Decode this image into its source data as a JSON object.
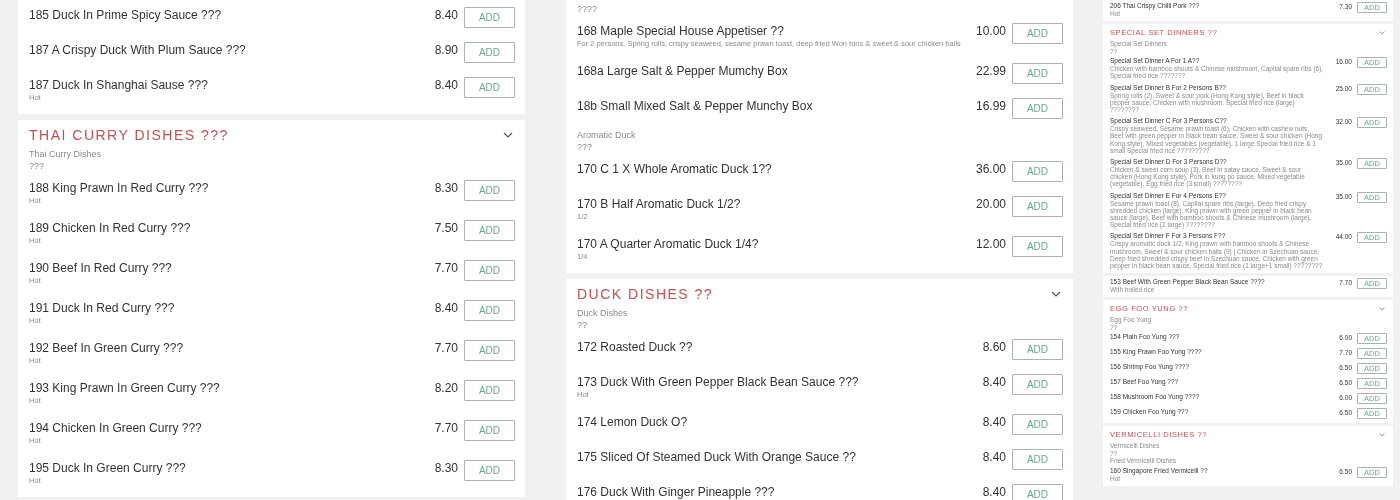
{
  "columns": [
    {
      "kind": "full",
      "cards": [
        {
          "rows": [
            {
              "kind": "item",
              "name": "185 Duck In Prime Spicy Sauce ???",
              "price": "8.40",
              "button": "ADD"
            },
            {
              "kind": "item",
              "name": "187 A Crispy Duck With Plum Sauce ???",
              "price": "8.90",
              "button": "ADD"
            },
            {
              "kind": "item",
              "name": "187 Duck In Shanghai Sause ???",
              "detail": "Hot",
              "price": "8.40",
              "button": "ADD"
            }
          ]
        },
        {
          "heading": "THAI CURRY DISHES ???",
          "rows": [
            {
              "kind": "subheading",
              "lines": [
                "Thai Curry Dishes",
                "???"
              ]
            },
            {
              "kind": "item",
              "name": "188 King Prawn In Red Curry ???",
              "detail": "Hot",
              "price": "8.30",
              "button": "ADD"
            },
            {
              "kind": "item",
              "name": "189 Chicken In Red Curry ???",
              "detail": "Hot",
              "price": "7.50",
              "button": "ADD"
            },
            {
              "kind": "item",
              "name": "190 Beef In Red Curry ???",
              "detail": "Hot",
              "price": "7.70",
              "button": "ADD"
            },
            {
              "kind": "item",
              "name": "191 Duck In Red Curry ???",
              "detail": "Hot",
              "price": "8.40",
              "button": "ADD"
            },
            {
              "kind": "item",
              "name": "192 Beef In Green Curry ???",
              "detail": "Hot",
              "price": "7.70",
              "button": "ADD"
            },
            {
              "kind": "item",
              "name": "193 King Prawn In Green Curry ???",
              "detail": "Hot",
              "price": "8.20",
              "button": "ADD"
            },
            {
              "kind": "item",
              "name": "194 Chicken In Green Curry ???",
              "detail": "Hot",
              "price": "7.70",
              "button": "ADD"
            },
            {
              "kind": "item",
              "name": "195 Duck In Green Curry ???",
              "detail": "Hot",
              "price": "8.30",
              "button": "ADD"
            }
          ]
        }
      ]
    },
    {
      "kind": "full",
      "cards": [
        {
          "rows": [
            {
              "kind": "subheading",
              "lines": [
                "????"
              ]
            },
            {
              "kind": "item",
              "name": "168 Maple Special House Appetiser ??",
              "detail": "For 2 persons. Spring rolls, crispy seaweed, sesame prawn toast, deep fried Won tons & sweet & sour chicken balls",
              "price": "10.00",
              "button": "ADD"
            },
            {
              "kind": "item",
              "name": "168a Large Salt & Pepper Mumchy Box",
              "price": "22.99",
              "button": "ADD"
            },
            {
              "kind": "item",
              "name": "18b Small Mixed Salt & Pepper Munchy Box",
              "price": "16.99",
              "button": "ADD"
            },
            {
              "kind": "subheading",
              "lines": [
                "Aromatic Duck",
                "???"
              ]
            },
            {
              "kind": "item",
              "name": "170 C 1 X Whole Aromatic Duck 1??",
              "price": "36.00",
              "button": "ADD"
            },
            {
              "kind": "item",
              "name": "170 B Half Aromatic Duck 1/2?",
              "detail": "1/2",
              "price": "20.00",
              "button": "ADD"
            },
            {
              "kind": "item",
              "name": "170 A Quarter Aromatic Duck 1/4?",
              "detail": "1/4",
              "price": "12.00",
              "button": "ADD"
            }
          ]
        },
        {
          "heading": "DUCK DISHES ??",
          "rows": [
            {
              "kind": "subheading",
              "lines": [
                "Duck Dishes",
                "??"
              ]
            },
            {
              "kind": "item",
              "name": "172 Roasted Duck ??",
              "price": "8.60",
              "button": "ADD"
            },
            {
              "kind": "item",
              "name": "173 Duck With Green Pepper Black Bean Sauce ???",
              "detail": "Hot",
              "price": "8.40",
              "button": "ADD"
            },
            {
              "kind": "item",
              "name": "174 Lemon Duck O?",
              "price": "8.40",
              "button": "ADD"
            },
            {
              "kind": "item",
              "name": "175 Sliced Of Steamed Duck With Orange Sauce ??",
              "price": "8.40",
              "button": "ADD"
            },
            {
              "kind": "item",
              "name": "176 Duck With Ginger Pineapple ???",
              "price": "8.40",
              "button": "ADD"
            }
          ]
        }
      ]
    },
    {
      "kind": "preview",
      "cards": [
        {
          "rows": [
            {
              "kind": "item",
              "name": "206 Thai Crispy Chilli Pork ???",
              "detail": "Hot",
              "price": "7.30",
              "button": "ADD"
            }
          ]
        },
        {
          "heading": "SPECIAL SET DINNERS ??",
          "rows": [
            {
              "kind": "subheading",
              "lines": [
                "Special Set Dinners",
                "??"
              ]
            },
            {
              "kind": "item",
              "name": "Special Set Dinner A For 1 A??",
              "detail": "Chicken with bamboo shoots & Chinese mushroom, Capital spare ribs (6), Special fried rice ???????",
              "price": "16.00",
              "button": "ADD"
            },
            {
              "kind": "item",
              "name": "Special Set Dinner B For 2 Persons B??",
              "detail": "Spring rolls (2), Sweet & sour pork (Hong Kong style), Beef in black pepper sauce, Chicken with mushroom, Special fried rice (large) ????????",
              "price": "25.00",
              "button": "ADD"
            },
            {
              "kind": "item",
              "name": "Special Set Dinner C For 3 Persons C??",
              "detail": "Crispy seaweed, Sesame prawn toast (6), Chicken with cashew nuts, Beef with green pepper in black bean sauce, Sweet & sour chicken (Hong Kong style), Mixed vegetables (vegetable), 1 large Special fried rice & 1 small Special fried rice ?????????",
              "price": "32.00",
              "button": "ADD"
            },
            {
              "kind": "item",
              "name": "Special Set Dinner D For 3 Persons D??",
              "detail": "Chicken & sweet corn soup (3), Beef in satay sauce, Sweet & sour chicken (Hong Kong style), Pork in kung po sauce, Mixed vegetable (vegetable), Egg fried rice (3 small) ????????",
              "price": "35.00",
              "button": "ADD"
            },
            {
              "kind": "item",
              "name": "Special Set Dinner E For 4 Persons E??",
              "detail": "Sesame prawn toast (8), Capital spare ribs (large), Deep fried crispy shredded chicken (large), King prawn with green pepper in black bean sauce (large), Beef with bamboo shoots & Chinese mushroom (large), Special fried rice (2 large) ????????",
              "price": "35.00",
              "button": "ADD"
            },
            {
              "kind": "item",
              "name": "Special Set Dinner F For 3 Persons F??",
              "detail": "Crispy aromatic duck 1/2, King prawn with bamboo shoots & Chinese mushroom, Sweet & sour chicken balls (9) | Chicken in Szechuan sauce, Deep fried shredded crispy beef in Szechuan sauce, Chicken with green pepper in black bean sauce, Special fried rice (1 large+1 small) ????????",
              "price": "44.00",
              "button": "ADD"
            }
          ]
        },
        {
          "rows": [
            {
              "kind": "item",
              "name": "153 Beef With Green Pepper Black Bean Sauce ????",
              "detail": "With boiled rice",
              "price": "7.70",
              "button": "ADD"
            }
          ]
        },
        {
          "heading": "EGG FOO YUNG ??",
          "rows": [
            {
              "kind": "subheading",
              "lines": [
                "Egg Foo Yung",
                "??"
              ]
            },
            {
              "kind": "item",
              "name": "154 Plain Foo Yung ???",
              "price": "6.00",
              "button": "ADD"
            },
            {
              "kind": "item",
              "name": "155 King Prawn Foo Yung ????",
              "price": "7.70",
              "button": "ADD"
            },
            {
              "kind": "item",
              "name": "156 Shrimp Foo Yung ????",
              "price": "6.50",
              "button": "ADD"
            },
            {
              "kind": "item",
              "name": "157 Beef Foo Yung ???",
              "price": "6.50",
              "button": "ADD"
            },
            {
              "kind": "item",
              "name": "158 Mushroom Foo Yung ????",
              "price": "6.00",
              "button": "ADD"
            },
            {
              "kind": "item",
              "name": "159 Chicken Foo Yung ???",
              "price": "6.50",
              "button": "ADD"
            }
          ]
        },
        {
          "heading": "VERMICELLI DISHES ??",
          "rows": [
            {
              "kind": "subheading",
              "lines": [
                "Vermicelli Dishes",
                "??",
                "Fried Vermicelli Dishes"
              ]
            },
            {
              "kind": "item",
              "name": "160 Singapore Fried Vermicelli ??",
              "detail": "Hot",
              "price": "6.50",
              "button": "ADD"
            }
          ]
        }
      ]
    }
  ]
}
